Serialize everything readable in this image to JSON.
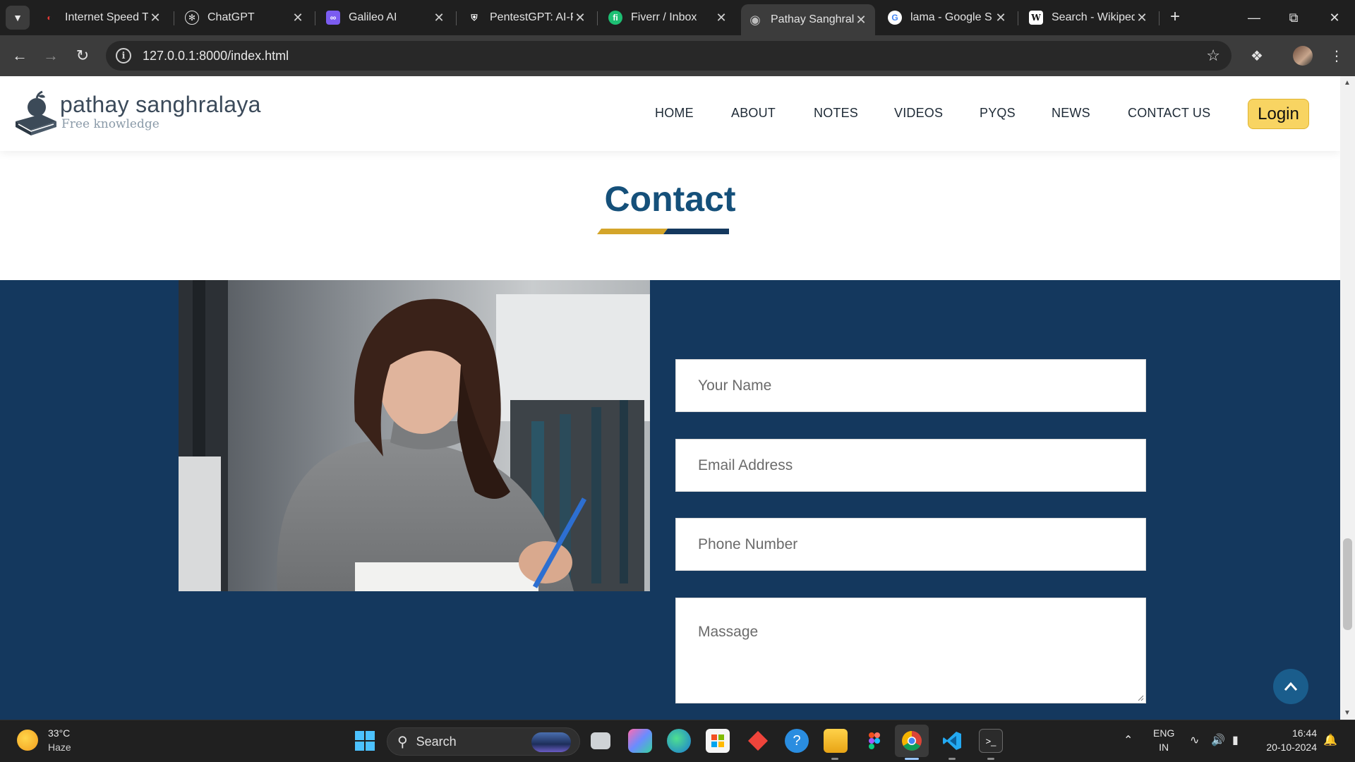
{
  "browser": {
    "tabs": [
      {
        "title": "Internet Speed Te",
        "favicon_color": "#c0392b",
        "favicon": "speedometer-icon"
      },
      {
        "title": "ChatGPT",
        "favicon_color": "#1f1f1f",
        "favicon": "openai-icon"
      },
      {
        "title": "Galileo AI",
        "favicon_color": "#7b5cf0",
        "favicon": "galileo-icon"
      },
      {
        "title": "PentestGPT: AI-P",
        "favicon_color": "#1f1f1f",
        "favicon": "shield-icon"
      },
      {
        "title": "Fiverr / Inbox",
        "favicon_color": "#1dbf73",
        "favicon": "fiverr-icon"
      },
      {
        "title": "Pathay Sanghrala",
        "favicon_color": "#5f6368",
        "favicon": "globe-icon",
        "active": true
      },
      {
        "title": "lama - Google S",
        "favicon_color": "#ffffff",
        "favicon": "google-icon"
      },
      {
        "title": "Search - Wikiped",
        "favicon_color": "#ffffff",
        "favicon": "wikipedia-icon"
      }
    ],
    "url": "127.0.0.1:8000/index.html"
  },
  "site": {
    "brand_name": "pathay sanghralaya",
    "brand_tagline": "Free knowledge",
    "nav": [
      "HOME",
      "ABOUT",
      "NOTES",
      "VIDEOS",
      "PYQS",
      "NEWS",
      "CONTACT US"
    ],
    "login_label": "Login"
  },
  "contact": {
    "title": "Contact",
    "underline_colors": [
      "#d4a52a",
      "#14385e"
    ],
    "fields": {
      "name_placeholder": "Your Name",
      "email_placeholder": "Email Address",
      "phone_placeholder": "Phone Number",
      "message_placeholder": "Massage"
    }
  },
  "colors": {
    "band": "#14385e",
    "title": "#15507a",
    "login": "#f8d462"
  },
  "taskbar": {
    "weather_temp": "33°C",
    "weather_desc": "Haze",
    "search_label": "Search",
    "lang_top": "ENG",
    "lang_bottom": "IN",
    "time": "16:44",
    "date": "20-10-2024"
  }
}
